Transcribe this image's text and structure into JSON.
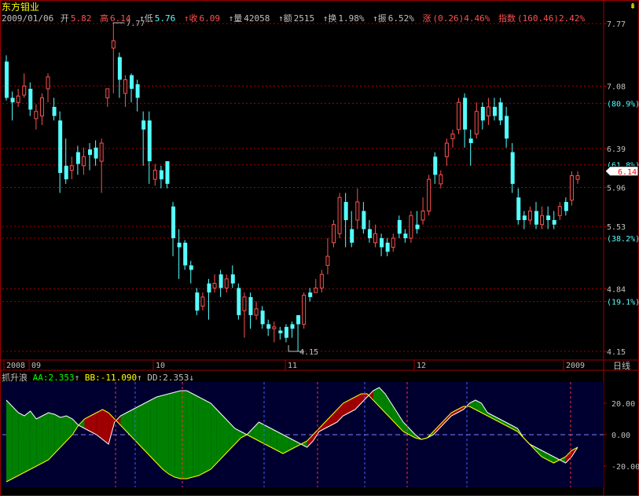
{
  "stock_name": "东方钼业",
  "quote": {
    "date": "2009/01/06",
    "open_label": "开",
    "open": "5.82",
    "high_label": "高",
    "high": "6.14",
    "low_label": "低",
    "low": "5.76",
    "close_label": "收",
    "close": "6.09",
    "volume_label": "量",
    "volume": "42058",
    "amount_label": "额",
    "amount": "2515",
    "turnover_label": "换",
    "turnover": "1.98%",
    "amplitude_label": "振",
    "amplitude": "6.52%",
    "change_label": "涨",
    "change": "(0.26)4.46%",
    "index_label": "指数",
    "index": "(160.46)2.42%"
  },
  "price_axis": [
    {
      "label": "7.77",
      "value": 7.77
    },
    {
      "label": "7.08",
      "value": 7.08
    },
    {
      "label": "(80.9%)",
      "value": 6.89
    },
    {
      "label": "6.39",
      "value": 6.39
    },
    {
      "label": "(61.8%)",
      "value": 6.21
    },
    {
      "label": "5.96",
      "value": 5.96
    },
    {
      "label": "5.53",
      "value": 5.53
    },
    {
      "label": "(38.2%)",
      "value": 5.4
    },
    {
      "label": "4.84",
      "value": 4.84
    },
    {
      "label": "(19.1%)",
      "value": 4.7
    },
    {
      "label": "4.15",
      "value": 4.15
    }
  ],
  "current_price_tag": "6.14",
  "high_marker": "7.77",
  "low_marker": "4.15",
  "date_axis": [
    "2008",
    "09",
    "10",
    "11",
    "12",
    "2009"
  ],
  "period_button": "日线",
  "indicator": {
    "name": "抓升浪",
    "aa_label": "AA:",
    "aa": "2.353",
    "bb_label": "BB:",
    "bb": "-11.090",
    "dd_label": "DD:",
    "dd": "2.353",
    "axis": [
      "20.00",
      "0.00",
      "-20.00"
    ]
  },
  "colors": {
    "up": "#ff5050",
    "down": "#54ffff",
    "grid": "#a00000",
    "ind_bg": "#000030",
    "green_fill": "#008000",
    "red_fill": "#a00000",
    "yellow": "#ffff00"
  },
  "icons": {
    "top_right": "up-arrow-icon"
  },
  "chart_data": {
    "type": "candlestick",
    "ylim": [
      4.15,
      7.77
    ],
    "candles": [
      [
        7.35,
        6.95,
        7.42,
        6.92
      ],
      [
        6.95,
        6.9,
        7.02,
        6.7
      ],
      [
        6.9,
        6.97,
        7.05,
        6.85
      ],
      [
        6.98,
        7.08,
        7.22,
        6.95
      ],
      [
        7.05,
        6.82,
        7.12,
        6.75
      ],
      [
        6.72,
        6.8,
        6.88,
        6.6
      ],
      [
        6.75,
        6.95,
        7.0,
        6.65
      ],
      [
        7.05,
        7.18,
        7.22,
        6.9
      ],
      [
        6.85,
        6.75,
        6.95,
        6.7
      ],
      [
        6.7,
        6.12,
        6.8,
        5.9
      ],
      [
        6.2,
        6.05,
        6.5,
        6.0
      ],
      [
        6.15,
        6.2,
        6.3,
        6.05
      ],
      [
        6.35,
        6.22,
        6.42,
        6.1
      ],
      [
        6.2,
        6.3,
        6.4,
        6.1
      ],
      [
        6.38,
        6.32,
        6.45,
        6.15
      ],
      [
        6.4,
        6.28,
        6.48,
        6.2
      ],
      [
        6.25,
        6.45,
        6.5,
        5.9
      ],
      [
        6.95,
        7.05,
        7.05,
        6.85
      ],
      [
        7.5,
        7.58,
        7.78,
        7.0
      ],
      [
        7.4,
        7.15,
        7.45,
        6.95
      ],
      [
        7.0,
        7.15,
        7.2,
        6.85
      ],
      [
        7.2,
        7.05,
        7.22,
        6.9
      ],
      [
        7.1,
        6.95,
        7.15,
        6.8
      ],
      [
        6.7,
        6.6,
        6.8,
        6.2
      ],
      [
        6.7,
        6.25,
        6.8,
        6.0
      ],
      [
        6.05,
        6.15,
        6.22,
        5.98
      ],
      [
        6.15,
        6.05,
        6.2,
        5.95
      ],
      [
        6.25,
        6.0,
        6.25,
        5.95
      ],
      [
        5.75,
        5.4,
        5.8,
        5.2
      ],
      [
        5.35,
        5.3,
        5.5,
        4.95
      ],
      [
        5.35,
        5.1,
        5.38,
        5.05
      ],
      [
        5.1,
        5.05,
        5.15,
        4.9
      ],
      [
        4.8,
        4.6,
        4.85,
        4.55
      ],
      [
        4.65,
        4.75,
        4.8,
        4.6
      ],
      [
        4.9,
        4.8,
        4.95,
        4.5
      ],
      [
        4.85,
        4.9,
        5.0,
        4.8
      ],
      [
        5.0,
        4.85,
        5.05,
        4.75
      ],
      [
        4.85,
        4.95,
        5.0,
        4.8
      ],
      [
        5.0,
        4.9,
        5.1,
        4.85
      ],
      [
        4.85,
        4.55,
        4.9,
        4.5
      ],
      [
        4.6,
        4.75,
        4.8,
        4.3
      ],
      [
        4.75,
        4.55,
        4.8,
        4.4
      ],
      [
        4.55,
        4.62,
        4.7,
        4.5
      ],
      [
        4.6,
        4.45,
        4.65,
        4.4
      ],
      [
        4.45,
        4.4,
        4.5,
        4.32
      ],
      [
        4.4,
        4.42,
        4.48,
        4.25
      ],
      [
        4.38,
        4.35,
        4.42,
        4.28
      ],
      [
        4.42,
        4.3,
        4.45,
        4.25
      ],
      [
        4.45,
        4.4,
        4.48,
        4.3
      ],
      [
        4.55,
        4.45,
        4.55,
        4.15
      ],
      [
        4.45,
        4.77,
        4.8,
        4.4
      ],
      [
        4.8,
        4.75,
        4.85,
        4.7
      ],
      [
        4.8,
        4.85,
        4.95,
        4.8
      ],
      [
        4.85,
        5.0,
        5.05,
        4.8
      ],
      [
        5.1,
        5.2,
        5.4,
        5.0
      ],
      [
        5.35,
        5.55,
        5.6,
        5.3
      ],
      [
        5.45,
        5.85,
        5.9,
        5.4
      ],
      [
        5.8,
        5.6,
        5.9,
        5.3
      ],
      [
        5.5,
        5.35,
        5.7,
        5.3
      ],
      [
        5.6,
        5.8,
        5.95,
        5.5
      ],
      [
        5.7,
        5.5,
        5.8,
        5.45
      ],
      [
        5.5,
        5.4,
        5.6,
        5.35
      ],
      [
        5.35,
        5.45,
        5.55,
        5.3
      ],
      [
        5.4,
        5.3,
        5.45,
        5.2
      ],
      [
        5.35,
        5.25,
        5.4,
        5.2
      ],
      [
        5.3,
        5.4,
        5.45,
        5.25
      ],
      [
        5.6,
        5.45,
        5.65,
        5.4
      ],
      [
        5.45,
        5.4,
        5.5,
        5.35
      ],
      [
        5.4,
        5.65,
        5.7,
        5.35
      ],
      [
        5.55,
        5.5,
        5.7,
        5.45
      ],
      [
        5.6,
        5.7,
        5.85,
        5.55
      ],
      [
        5.7,
        6.05,
        6.1,
        5.65
      ],
      [
        6.3,
        6.1,
        6.35,
        6.0
      ],
      [
        6.0,
        6.1,
        6.15,
        5.95
      ],
      [
        6.3,
        6.45,
        6.5,
        6.2
      ],
      [
        6.5,
        6.55,
        6.6,
        6.4
      ],
      [
        6.6,
        6.9,
        6.95,
        6.55
      ],
      [
        6.95,
        6.6,
        7.0,
        6.4
      ],
      [
        6.5,
        6.45,
        6.6,
        6.2
      ],
      [
        6.55,
        6.8,
        6.9,
        6.5
      ],
      [
        6.85,
        6.7,
        6.9,
        6.6
      ],
      [
        6.75,
        6.85,
        6.95,
        6.65
      ],
      [
        6.85,
        6.75,
        6.95,
        6.7
      ],
      [
        6.9,
        6.7,
        6.95,
        6.65
      ],
      [
        6.75,
        6.5,
        6.85,
        6.4
      ],
      [
        6.35,
        6.0,
        6.45,
        5.9
      ],
      [
        5.85,
        5.6,
        5.95,
        5.55
      ],
      [
        5.65,
        5.6,
        5.7,
        5.5
      ],
      [
        5.6,
        5.7,
        5.75,
        5.55
      ],
      [
        5.7,
        5.55,
        5.8,
        5.5
      ],
      [
        5.55,
        5.65,
        5.75,
        5.5
      ],
      [
        5.65,
        5.6,
        5.75,
        5.5
      ],
      [
        5.6,
        5.55,
        5.7,
        5.5
      ],
      [
        5.65,
        5.75,
        5.8,
        5.6
      ],
      [
        5.8,
        5.7,
        5.85,
        5.65
      ],
      [
        5.82,
        6.09,
        6.14,
        5.76
      ],
      [
        6.05,
        6.09,
        6.14,
        6.0
      ]
    ],
    "indicator_series": {
      "upper_green": [
        22,
        18,
        14,
        12,
        15,
        10,
        12,
        14,
        13,
        11,
        12,
        10,
        6,
        4,
        2,
        0,
        -3,
        -6,
        8,
        12,
        14,
        16,
        18,
        20,
        22,
        24,
        25,
        26,
        27,
        28,
        28,
        26,
        24,
        22,
        20,
        16,
        12,
        8,
        4,
        2,
        0,
        4,
        8,
        6,
        4,
        2,
        0,
        -2,
        -4,
        -6,
        -8,
        -4,
        2,
        4,
        6,
        8,
        12,
        14,
        16,
        20,
        24,
        28,
        30,
        26,
        20,
        14,
        8,
        4,
        0,
        -3,
        -2,
        0,
        4,
        8,
        12,
        14,
        16,
        20,
        22,
        20,
        14,
        12,
        10,
        8,
        6,
        4,
        -2,
        -6,
        -8,
        -10,
        -12,
        -14,
        -16,
        -18,
        -14,
        -8
      ],
      "lower_yellow": [
        -30,
        -28,
        -26,
        -24,
        -22,
        -20,
        -18,
        -16,
        -12,
        -8,
        -4,
        0,
        6,
        10,
        12,
        14,
        16,
        14,
        10,
        6,
        2,
        -2,
        -6,
        -10,
        -14,
        -18,
        -22,
        -25,
        -27,
        -28,
        -28,
        -27,
        -26,
        -24,
        -22,
        -18,
        -14,
        -10,
        -6,
        -2,
        0,
        -2,
        -4,
        -6,
        -8,
        -10,
        -12,
        -10,
        -8,
        -6,
        -4,
        0,
        4,
        8,
        12,
        16,
        20,
        22,
        24,
        26,
        26,
        22,
        18,
        14,
        10,
        6,
        2,
        0,
        -2,
        -3,
        -2,
        2,
        6,
        10,
        14,
        16,
        18,
        18,
        16,
        14,
        12,
        10,
        8,
        6,
        4,
        2,
        -2,
        -6,
        -10,
        -14,
        -16,
        -18,
        -16,
        -14,
        -10,
        -8
      ]
    }
  }
}
